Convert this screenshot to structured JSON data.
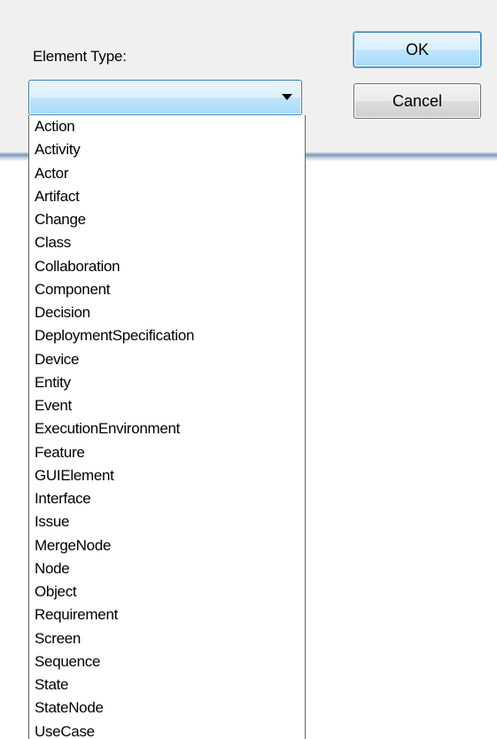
{
  "dialog": {
    "element_type_label": "Element Type:",
    "combo_value": "",
    "ok_label": "OK",
    "cancel_label": "Cancel"
  },
  "dropdown": {
    "items": [
      "Action",
      "Activity",
      "Actor",
      "Artifact",
      "Change",
      "Class",
      "Collaboration",
      "Component",
      "Decision",
      "DeploymentSpecification",
      "Device",
      "Entity",
      "Event",
      "ExecutionEnvironment",
      "Feature",
      "GUIElement",
      "Interface",
      "Issue",
      "MergeNode",
      "Node",
      "Object",
      "Requirement",
      "Screen",
      "Sequence",
      "State",
      "StateNode",
      "UseCase"
    ]
  },
  "icons": {
    "combo_arrow": "chevron-down-icon"
  },
  "colors": {
    "dialog_background": "#f0f0f0",
    "focus_border": "#3c7fb1",
    "button_border": "#707070"
  }
}
